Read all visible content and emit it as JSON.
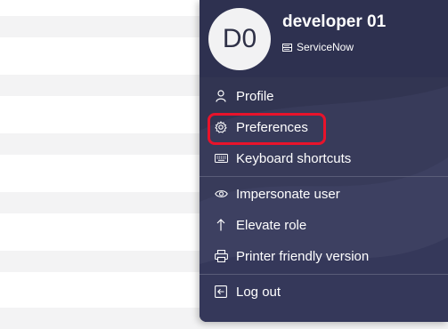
{
  "user": {
    "initials": "D0",
    "name": "developer 01",
    "instance_icon": "server-icon",
    "instance_name": "ServiceNow"
  },
  "menu": {
    "items": [
      {
        "label": "Profile",
        "icon": "user-icon"
      },
      {
        "label": "Preferences",
        "icon": "gear-icon"
      },
      {
        "label": "Keyboard shortcuts",
        "icon": "keyboard-icon"
      },
      {
        "label": "Impersonate user",
        "icon": "eye-icon"
      },
      {
        "label": "Elevate role",
        "icon": "arrow-up-icon"
      },
      {
        "label": "Printer friendly version",
        "icon": "printer-icon"
      },
      {
        "label": "Log out",
        "icon": "logout-icon"
      }
    ]
  },
  "colors": {
    "menu_background": "#323552",
    "highlight": "#e8132b"
  }
}
